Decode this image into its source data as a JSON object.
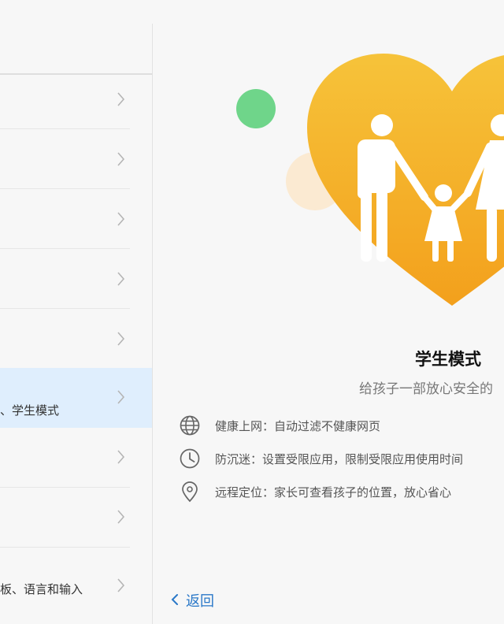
{
  "left_list": {
    "rows": [
      {
        "label": ""
      },
      {
        "label": ""
      },
      {
        "label": ""
      },
      {
        "label": ""
      },
      {
        "label": ""
      },
      {
        "label": "、学生模式",
        "selected": true
      },
      {
        "label": ""
      },
      {
        "label": ""
      },
      {
        "label": "板、语言和输入"
      }
    ]
  },
  "student_mode": {
    "title": "学生模式",
    "subtitle": "给孩子一部放心安全的",
    "features": [
      {
        "icon": "globe-icon",
        "text": "健康上网：自动过滤不健康网页"
      },
      {
        "icon": "clock-icon",
        "text": "防沉迷：设置受限应用，限制受限应用使用时间"
      },
      {
        "icon": "location-pin-icon",
        "text": "远程定位：家长可查看孩子的位置，放心省心"
      }
    ]
  },
  "back_label": "返回",
  "colors": {
    "accent": "#2a78c8",
    "selected_row": "#dfeefd",
    "heart_top": "#f6c33a",
    "heart_bottom": "#f3a01c",
    "green_dot": "#6fd58a"
  }
}
